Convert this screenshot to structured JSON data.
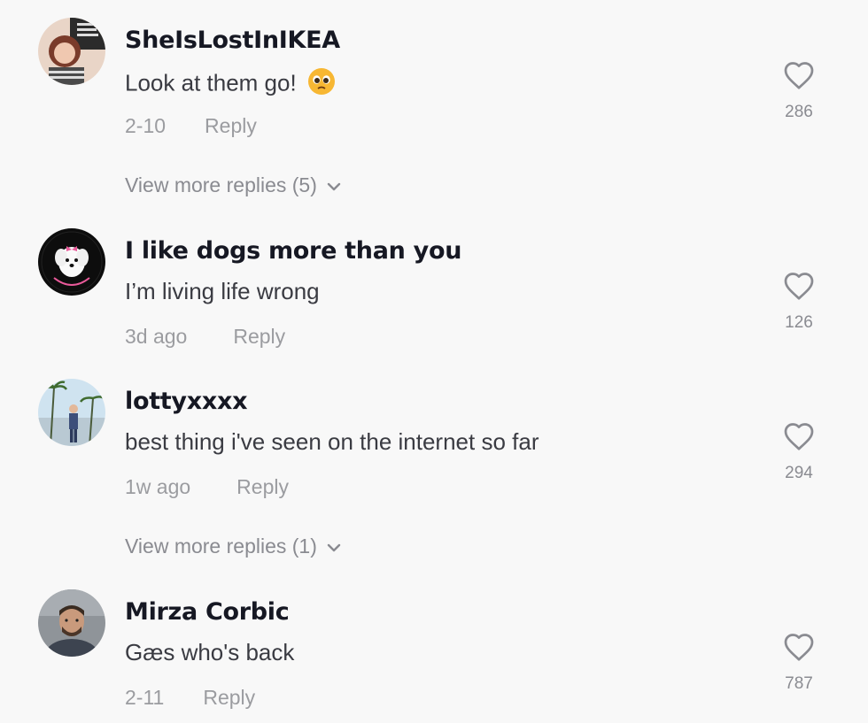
{
  "comments": [
    {
      "username": "SheIsLostInIKEA",
      "text": "Look at them go!",
      "emoji": "pleading-face-emoji",
      "date": "2-10",
      "reply_label": "Reply",
      "likes": "286",
      "view_more": "View more replies (5)"
    },
    {
      "username": "I like dogs more than you",
      "text": "I’m living life wrong",
      "date": "3d ago",
      "reply_label": "Reply",
      "likes": "126"
    },
    {
      "username": "lottyxxxx",
      "text": "best thing i've seen on the internet so far",
      "date": "1w ago",
      "reply_label": "Reply",
      "likes": "294",
      "view_more": "View more replies (1)"
    },
    {
      "username": "Mirza Corbic",
      "text": "Gæs who's back",
      "date": "2-11",
      "reply_label": "Reply",
      "likes": "787"
    }
  ],
  "colors": {
    "background": "#f8f8f8",
    "username": "#161823",
    "text": "#3a3b42",
    "meta": "#9b9ca0"
  },
  "icons": [
    "heart-outline-icon",
    "chevron-down-icon"
  ]
}
